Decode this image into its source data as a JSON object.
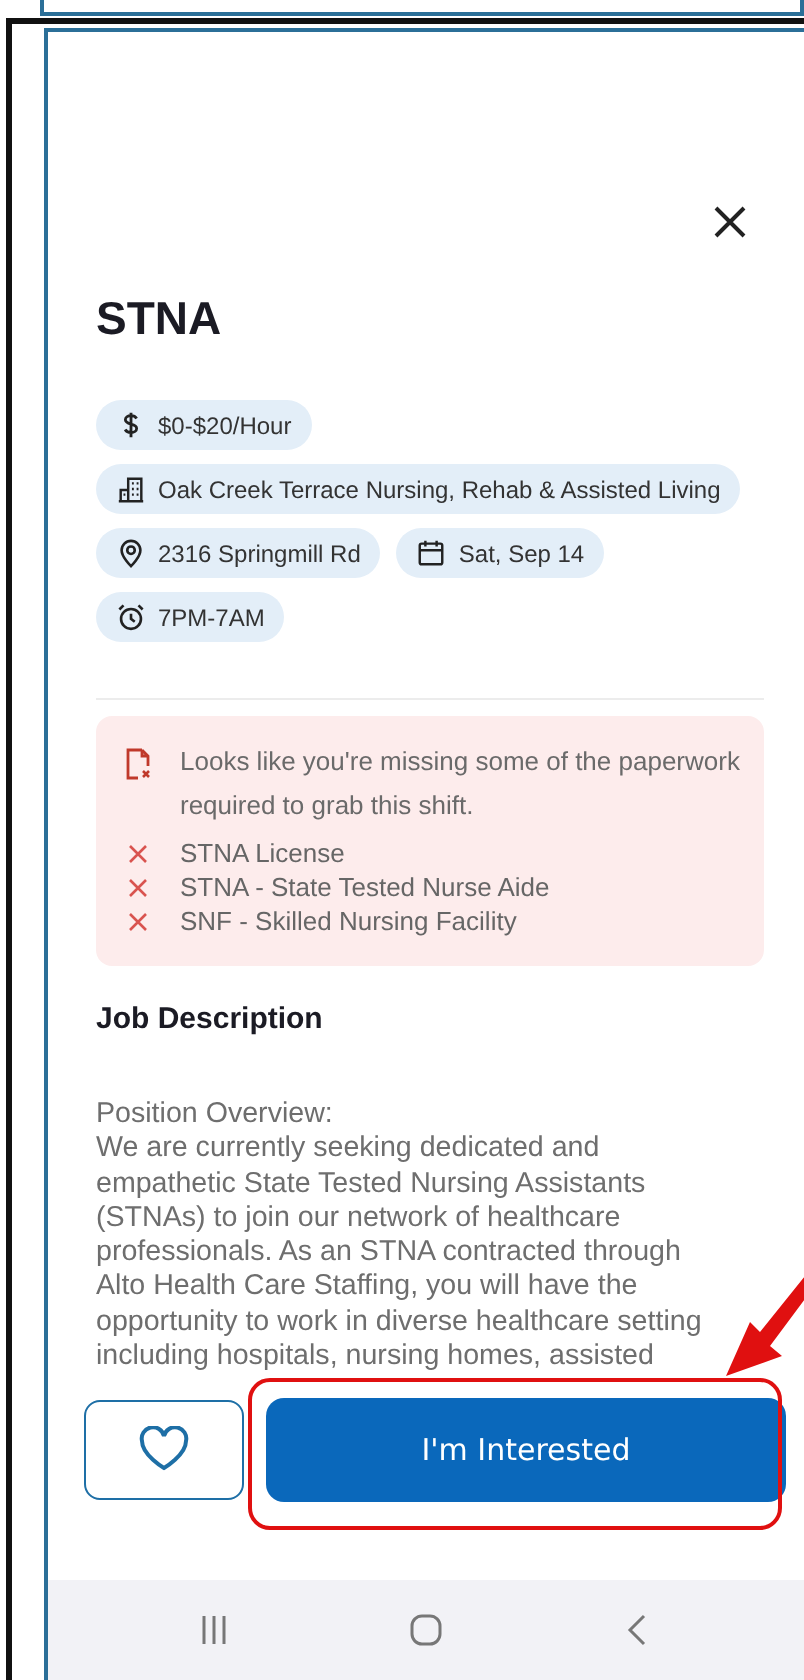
{
  "title": "STNA",
  "chips": [
    {
      "kind": "money",
      "label": "$0-$20/Hour"
    },
    {
      "kind": "building",
      "label": "Oak Creek Terrace Nursing, Rehab & Assisted Living"
    },
    {
      "kind": "pin",
      "label": "2316 Springmill Rd"
    },
    {
      "kind": "calendar",
      "label": "Sat, Sep 14"
    },
    {
      "kind": "clock",
      "label": "7PM-7AM"
    }
  ],
  "alert": {
    "message": "Looks like you're missing some of the paperwork required to grab this shift.",
    "missing": [
      "STNA License",
      "STNA - State Tested Nurse Aide",
      "SNF - Skilled Nursing Facility"
    ]
  },
  "section_title": "Job Description",
  "description_lines": [
    "Position Overview:",
    "We are currently seeking dedicated and",
    "empathetic State Tested Nursing Assistants",
    "(STNAs) to join our network of healthcare",
    "professionals. As an STNA contracted through",
    "Alto Health Care Staffing, you will have the",
    "opportunity to work in diverse healthcare setting",
    "including hospitals, nursing homes, assisted"
  ],
  "primary_button": "I'm Interested"
}
